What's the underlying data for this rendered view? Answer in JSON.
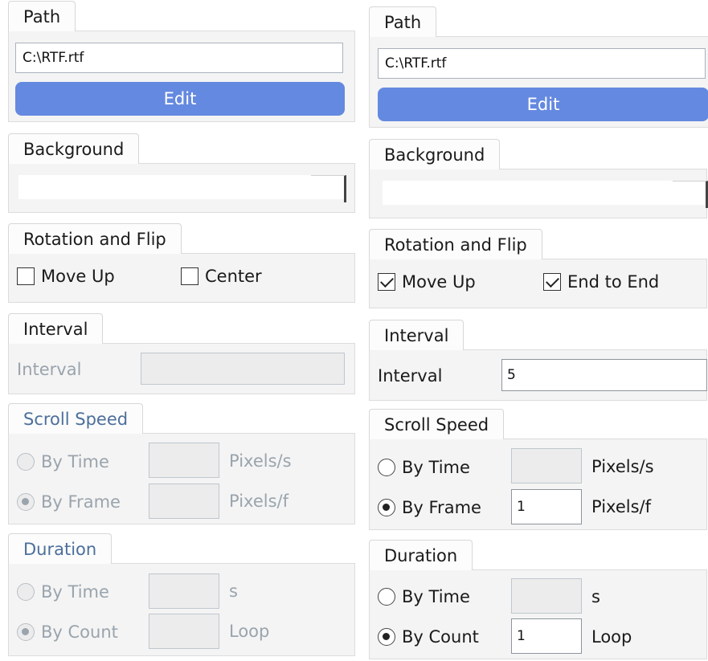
{
  "left": {
    "path": {
      "tab": "Path",
      "value": "C:\\RTF.rtf",
      "edit_label": "Edit"
    },
    "background": {
      "tab": "Background"
    },
    "rotation": {
      "tab": "Rotation and Flip",
      "opt1": "Move Up",
      "opt2": "Center"
    },
    "interval": {
      "tab": "Interval",
      "label": "Interval"
    },
    "scroll": {
      "tab": "Scroll Speed",
      "by_time": "By Time",
      "by_frame": "By Frame",
      "unit_time": "Pixels/s",
      "unit_frame": "Pixels/f"
    },
    "duration": {
      "tab": "Duration",
      "by_time": "By Time",
      "by_count": "By Count",
      "unit_time": "s",
      "unit_count": "Loop"
    }
  },
  "right": {
    "path": {
      "tab": "Path",
      "value": "C:\\RTF.rtf",
      "edit_label": "Edit"
    },
    "background": {
      "tab": "Background"
    },
    "rotation": {
      "tab": "Rotation and Flip",
      "opt1": "Move Up",
      "opt2": "End to End"
    },
    "interval": {
      "tab": "Interval",
      "label": "Interval",
      "value": "5"
    },
    "scroll": {
      "tab": "Scroll Speed",
      "by_time": "By Time",
      "by_frame": "By Frame",
      "unit_time": "Pixels/s",
      "unit_frame": "Pixels/f",
      "frame_value": "1"
    },
    "duration": {
      "tab": "Duration",
      "by_time": "By Time",
      "by_count": "By Count",
      "unit_time": "s",
      "unit_count": "Loop",
      "count_value": "1"
    }
  },
  "colors": {
    "accent": "#6489e0",
    "disabled_text": "#9aa4ad"
  }
}
